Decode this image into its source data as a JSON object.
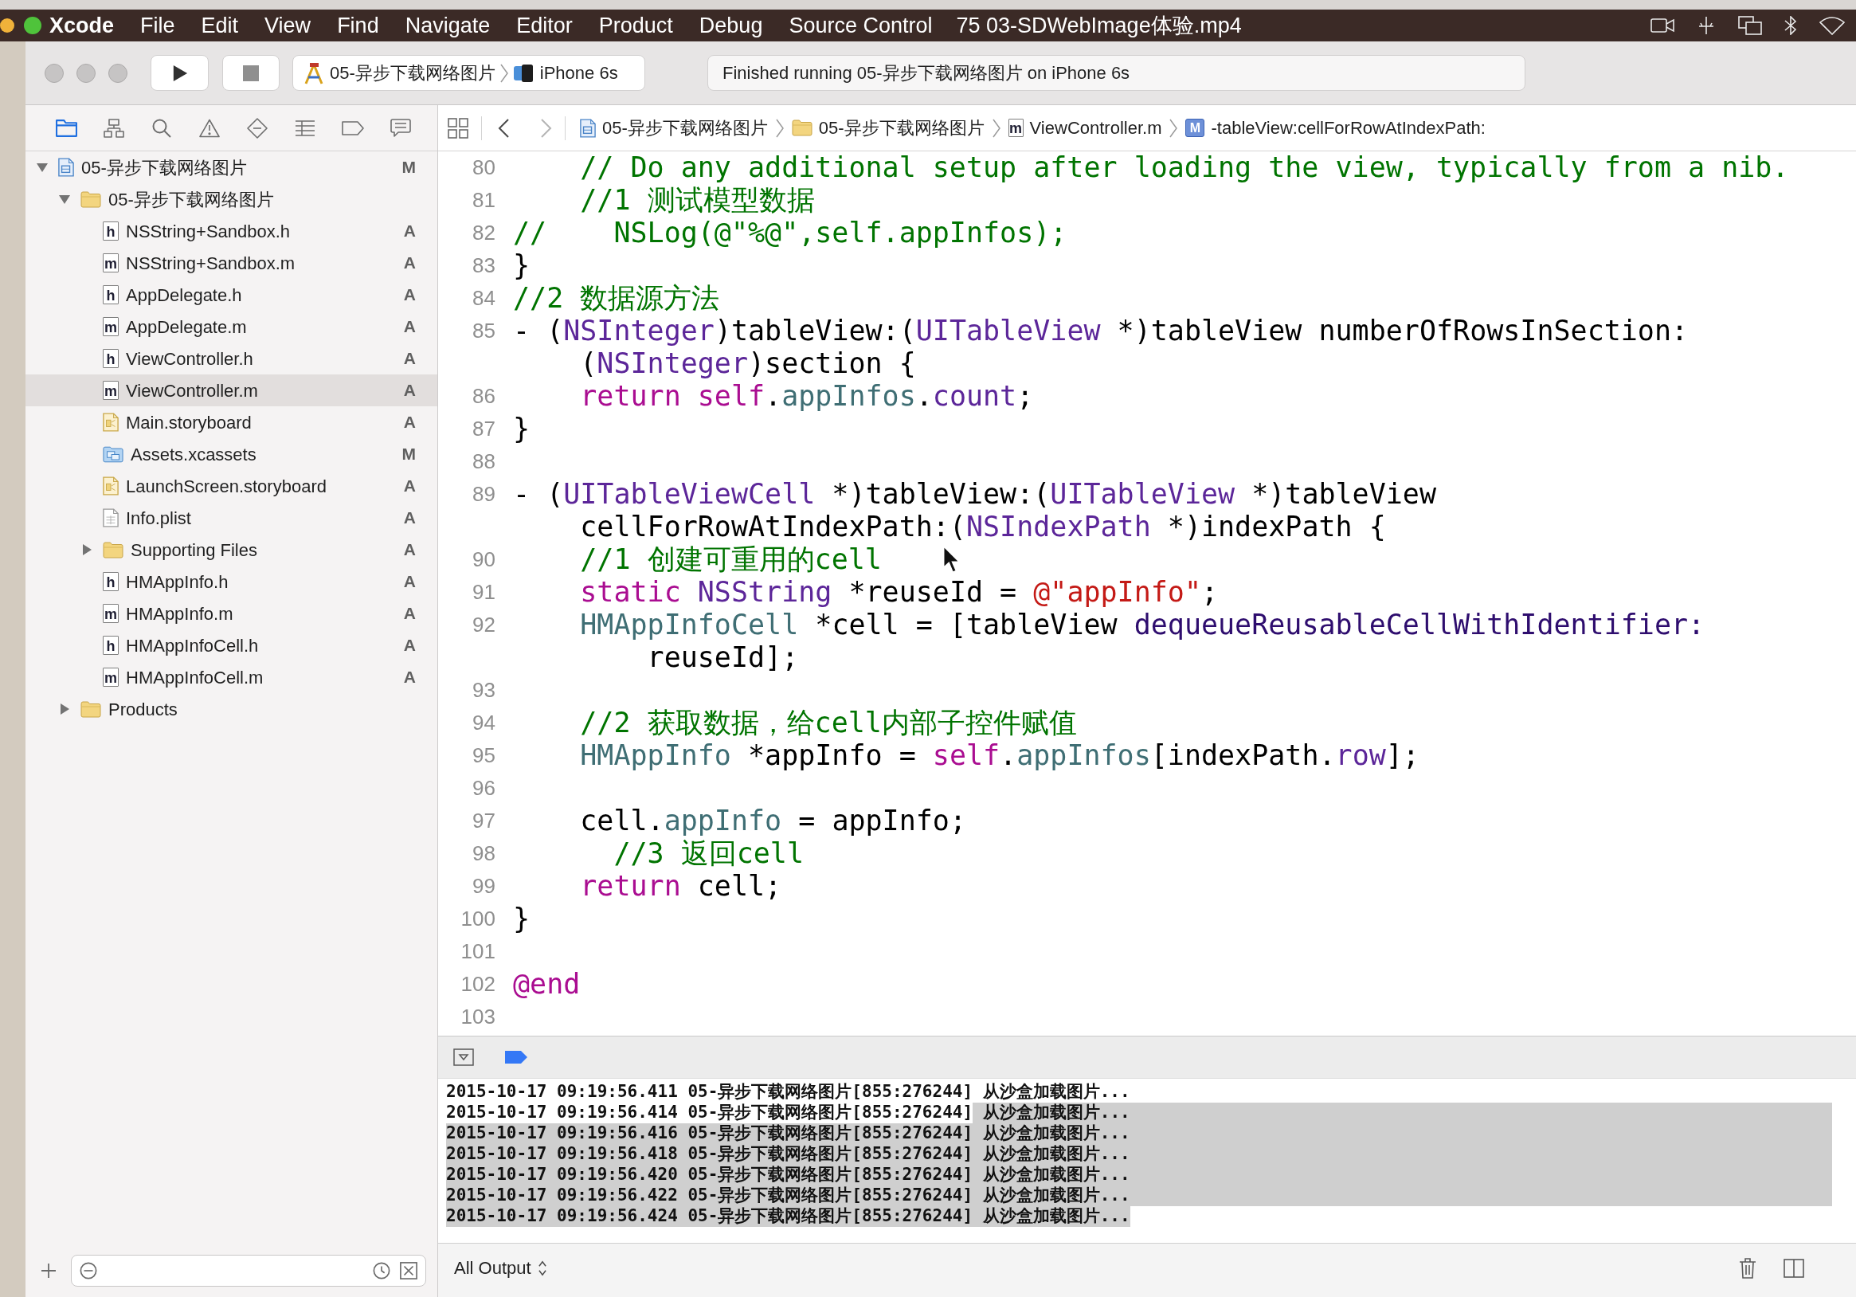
{
  "menu_bar": {
    "items": [
      {
        "label": "Xcode",
        "kind": "app"
      },
      {
        "label": "File",
        "kind": "menu"
      },
      {
        "label": "Edit",
        "kind": "menu"
      },
      {
        "label": "View",
        "kind": "menu"
      },
      {
        "label": "Find",
        "kind": "menu"
      },
      {
        "label": "Navigate",
        "kind": "menu"
      },
      {
        "label": "Editor",
        "kind": "menu"
      },
      {
        "label": "Product",
        "kind": "menu"
      },
      {
        "label": "Debug",
        "kind": "menu"
      },
      {
        "label": "Source Control",
        "kind": "menu"
      }
    ],
    "video_title": "75 03-SDWebImage体验.mp4"
  },
  "toolbar": {
    "run_controls": [
      {
        "kind": "run",
        "disabled": false
      },
      {
        "kind": "stop",
        "disabled": true
      }
    ],
    "scheme": {
      "project": "05-异步下载网络图片",
      "device": "iPhone 6s"
    },
    "status": "Finished running 05-异步下载网络图片 on iPhone 6s"
  },
  "navigator": {
    "tabs": [
      {
        "kind": "project",
        "selected": true
      },
      {
        "kind": "symbol",
        "selected": false
      },
      {
        "kind": "find",
        "selected": false
      },
      {
        "kind": "issue",
        "selected": false
      },
      {
        "kind": "test",
        "selected": false
      },
      {
        "kind": "debug",
        "selected": false
      },
      {
        "kind": "breakpoint",
        "selected": false
      },
      {
        "kind": "report",
        "selected": false
      }
    ],
    "tree": [
      {
        "name": "05-异步下载网络图片",
        "kind": "project",
        "status": "M",
        "expanded": true,
        "selected": false,
        "children": [
          {
            "name": "05-异步下载网络图片",
            "kind": "group",
            "expanded": true,
            "selected": false,
            "children": [
              {
                "name": "NSString+Sandbox.h",
                "kind": "source",
                "icon_text": "h",
                "status": "A",
                "selected": false
              },
              {
                "name": "NSString+Sandbox.m",
                "kind": "source",
                "icon_text": "m",
                "status": "A",
                "selected": false
              },
              {
                "name": "AppDelegate.h",
                "kind": "source",
                "icon_text": "h",
                "status": "A",
                "selected": false
              },
              {
                "name": "AppDelegate.m",
                "kind": "source",
                "icon_text": "m",
                "status": "A",
                "selected": false
              },
              {
                "name": "ViewController.h",
                "kind": "source",
                "icon_text": "h",
                "status": "A",
                "selected": false
              },
              {
                "name": "ViewController.m",
                "kind": "source",
                "icon_text": "m",
                "status": "A",
                "selected": true
              },
              {
                "name": "Main.storyboard",
                "kind": "storyboard",
                "status": "A",
                "selected": false
              },
              {
                "name": "Assets.xcassets",
                "kind": "assets",
                "status": "M",
                "selected": false
              },
              {
                "name": "LaunchScreen.storyboard",
                "kind": "storyboard",
                "status": "A",
                "selected": false
              },
              {
                "name": "Info.plist",
                "kind": "plist",
                "status": "A",
                "selected": false
              },
              {
                "name": "Supporting Files",
                "kind": "group",
                "status": "A",
                "expanded": false,
                "selected": false
              },
              {
                "name": "HMAppInfo.h",
                "kind": "source",
                "icon_text": "h",
                "status": "A",
                "selected": false
              },
              {
                "name": "HMAppInfo.m",
                "kind": "source",
                "icon_text": "m",
                "status": "A",
                "selected": false
              },
              {
                "name": "HMAppInfoCell.h",
                "kind": "source",
                "icon_text": "h",
                "status": "A",
                "selected": false
              },
              {
                "name": "HMAppInfoCell.m",
                "kind": "source",
                "icon_text": "m",
                "status": "A",
                "selected": false
              }
            ]
          },
          {
            "name": "Products",
            "kind": "group",
            "expanded": false,
            "selected": false
          }
        ]
      }
    ]
  },
  "jump_bar": {
    "navigation": [
      {
        "kind": "back",
        "disabled": false
      },
      {
        "kind": "forward",
        "disabled": true
      }
    ],
    "path": [
      {
        "kind": "project",
        "label": "05-异步下载网络图片"
      },
      {
        "kind": "group",
        "label": "05-异步下载网络图片"
      },
      {
        "kind": "source",
        "icon_text": "m",
        "label": "ViewController.m"
      },
      {
        "kind": "method",
        "icon_text": "M",
        "label": "-tableView:cellForRowAtIndexPath:"
      }
    ]
  },
  "editor": {
    "rows": [
      {
        "number": "80",
        "tokens": [
          {
            "kind": "comment",
            "text": "    // Do any additional setup after loading the view, typically from a nib."
          }
        ]
      },
      {
        "number": "81",
        "tokens": [
          {
            "kind": "comment",
            "text": "    //1 测试模型数据"
          }
        ]
      },
      {
        "number": "82",
        "tokens": [
          {
            "kind": "comment",
            "text": "//    NSLog(@\"%@\",self.appInfos);"
          }
        ]
      },
      {
        "number": "83",
        "tokens": [
          {
            "kind": "plain",
            "text": "}"
          }
        ]
      },
      {
        "number": "84",
        "tokens": [
          {
            "kind": "comment",
            "text": "//2 数据源方法"
          }
        ]
      },
      {
        "number": "85",
        "tokens": [
          {
            "kind": "plain",
            "text": "- ("
          },
          {
            "kind": "system_type",
            "text": "NSInteger"
          },
          {
            "kind": "plain",
            "text": ")tableView:("
          },
          {
            "kind": "system_type",
            "text": "UITableView"
          },
          {
            "kind": "plain",
            "text": " *)tableView numberOfRowsInSection:"
          }
        ]
      },
      {
        "tokens": [
          {
            "kind": "plain",
            "text": "    ("
          },
          {
            "kind": "system_type",
            "text": "NSInteger"
          },
          {
            "kind": "plain",
            "text": ")section {"
          }
        ]
      },
      {
        "number": "86",
        "tokens": [
          {
            "kind": "keyword",
            "text": "    return self"
          },
          {
            "kind": "plain",
            "text": "."
          },
          {
            "kind": "project",
            "text": "appInfos"
          },
          {
            "kind": "plain",
            "text": "."
          },
          {
            "kind": "system",
            "text": "count"
          },
          {
            "kind": "plain",
            "text": ";"
          }
        ]
      },
      {
        "number": "87",
        "tokens": [
          {
            "kind": "plain",
            "text": "}"
          }
        ]
      },
      {
        "number": "88"
      },
      {
        "number": "89",
        "tokens": [
          {
            "kind": "plain",
            "text": "- ("
          },
          {
            "kind": "system_type",
            "text": "UITableViewCell"
          },
          {
            "kind": "plain",
            "text": " *)tableView:("
          },
          {
            "kind": "system_type",
            "text": "UITableView"
          },
          {
            "kind": "plain",
            "text": " *)tableView"
          }
        ]
      },
      {
        "tokens": [
          {
            "kind": "plain",
            "text": "    cellForRowAtIndexPath:("
          },
          {
            "kind": "system_type",
            "text": "NSIndexPath"
          },
          {
            "kind": "plain",
            "text": " *)indexPath {"
          }
        ]
      },
      {
        "number": "90",
        "tokens": [
          {
            "kind": "comment",
            "text": "    //1 创建可重用的cell"
          }
        ]
      },
      {
        "number": "91",
        "tokens": [
          {
            "kind": "keyword",
            "text": "    static "
          },
          {
            "kind": "system_type",
            "text": "NSString"
          },
          {
            "kind": "plain",
            "text": " *reuseId = "
          },
          {
            "kind": "string",
            "text": "@\"appInfo\""
          },
          {
            "kind": "plain",
            "text": ";"
          }
        ]
      },
      {
        "number": "92",
        "tokens": [
          {
            "kind": "project",
            "text": "    HMAppInfoCell"
          },
          {
            "kind": "plain",
            "text": " *cell = [tableView "
          },
          {
            "kind": "system_method",
            "text": "dequeueReusableCellWithIdentifier:"
          }
        ]
      },
      {
        "tokens": [
          {
            "kind": "plain",
            "text": "        reuseId];"
          }
        ]
      },
      {
        "number": "93"
      },
      {
        "number": "94",
        "tokens": [
          {
            "kind": "comment",
            "text": "    //2 获取数据，给cell内部子控件赋值"
          }
        ]
      },
      {
        "number": "95",
        "tokens": [
          {
            "kind": "project",
            "text": "    HMAppInfo"
          },
          {
            "kind": "plain",
            "text": " *appInfo = "
          },
          {
            "kind": "keyword",
            "text": "self"
          },
          {
            "kind": "plain",
            "text": "."
          },
          {
            "kind": "project",
            "text": "appInfos"
          },
          {
            "kind": "plain",
            "text": "[indexPath."
          },
          {
            "kind": "system",
            "text": "row"
          },
          {
            "kind": "plain",
            "text": "];"
          }
        ]
      },
      {
        "number": "96"
      },
      {
        "number": "97",
        "tokens": [
          {
            "kind": "plain",
            "text": "    cell."
          },
          {
            "kind": "project",
            "text": "appInfo"
          },
          {
            "kind": "plain",
            "text": " = appInfo;"
          }
        ]
      },
      {
        "number": "98",
        "tokens": [
          {
            "kind": "comment",
            "text": "      //3 返回cell"
          }
        ]
      },
      {
        "number": "99",
        "tokens": [
          {
            "kind": "keyword",
            "text": "    return"
          },
          {
            "kind": "plain",
            "text": " cell;"
          }
        ]
      },
      {
        "number": "100",
        "tokens": [
          {
            "kind": "plain",
            "text": "}"
          }
        ]
      },
      {
        "number": "101"
      },
      {
        "number": "102",
        "tokens": [
          {
            "kind": "keyword",
            "text": "@end"
          }
        ]
      },
      {
        "number": "103"
      }
    ]
  },
  "debug_bar": {
    "breakpoints_active": true
  },
  "console": {
    "lines": [
      {
        "parts": [
          {
            "text": "2015-10-17 09:19:56.411 05-异步下载网络图片[855:276244] 从沙盒加载图片...",
            "selected": false
          }
        ],
        "selected": false
      },
      {
        "parts": [
          {
            "text": "2015-10-17 09:19:56.414 05-异步下载网络图片[855:276244]",
            "selected": false
          },
          {
            "text": " 从沙盒加载图片...",
            "selected": true
          }
        ],
        "selected": true
      },
      {
        "parts": [
          {
            "text": "2015-10-17 09:19:56.416 05-异步下载网络图片[855:276244] 从沙盒加载图片...",
            "selected": true
          }
        ],
        "selected": true
      },
      {
        "parts": [
          {
            "text": "2015-10-17 09:19:56.418 05-异步下载网络图片[855:276244] 从沙盒加载图片...",
            "selected": true
          }
        ],
        "selected": true
      },
      {
        "parts": [
          {
            "text": "2015-10-17 09:19:56.420 05-异步下载网络图片[855:276244] 从沙盒加载图片...",
            "selected": true
          }
        ],
        "selected": true
      },
      {
        "parts": [
          {
            "text": "2015-10-17 09:19:56.422 05-异步下载网络图片[855:276244] 从沙盒加载图片...",
            "selected": true
          }
        ],
        "selected": true
      },
      {
        "parts": [
          {
            "text": "2015-10-17 09:19:56.424 05-异步下载网络图片[855:276244] 从沙盒加载图片...",
            "selected": true
          }
        ],
        "selected": false
      }
    ],
    "filter": "All Output"
  }
}
